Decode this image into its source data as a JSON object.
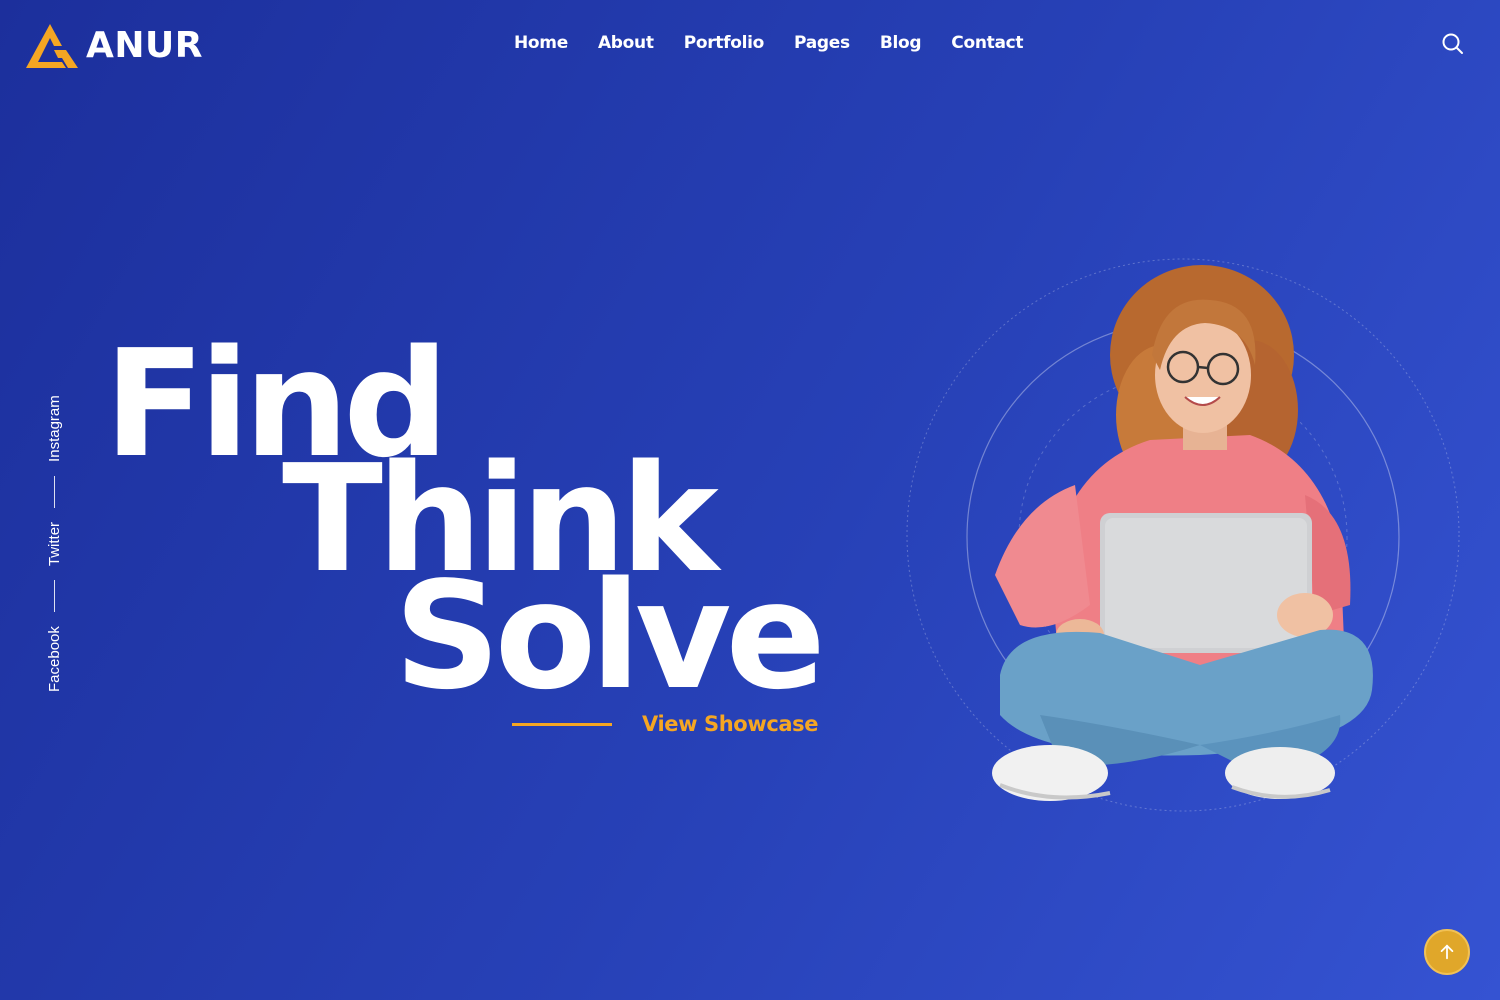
{
  "brand": {
    "name": "ANUR",
    "logo_icon": "triangle-logo-icon",
    "accent_color": "#f5a623"
  },
  "nav": {
    "items": [
      {
        "label": "Home"
      },
      {
        "label": "About"
      },
      {
        "label": "Portfolio"
      },
      {
        "label": "Pages"
      },
      {
        "label": "Blog"
      },
      {
        "label": "Contact"
      }
    ]
  },
  "header": {
    "search_icon": "search-icon"
  },
  "socials": {
    "items": [
      {
        "label": "Facebook"
      },
      {
        "label": "Twitter"
      },
      {
        "label": "Instagram"
      }
    ]
  },
  "hero": {
    "words": [
      "Find",
      "Think",
      "Solve"
    ],
    "cta_label": "View Showcase",
    "image_icon": "woman-with-laptop-illustration"
  },
  "back_to_top": {
    "icon": "arrow-up-icon"
  },
  "colors": {
    "background_start": "#1c2f9c",
    "background_end": "#3553d2",
    "accent": "#f5a623",
    "button": "#e0a72a"
  }
}
